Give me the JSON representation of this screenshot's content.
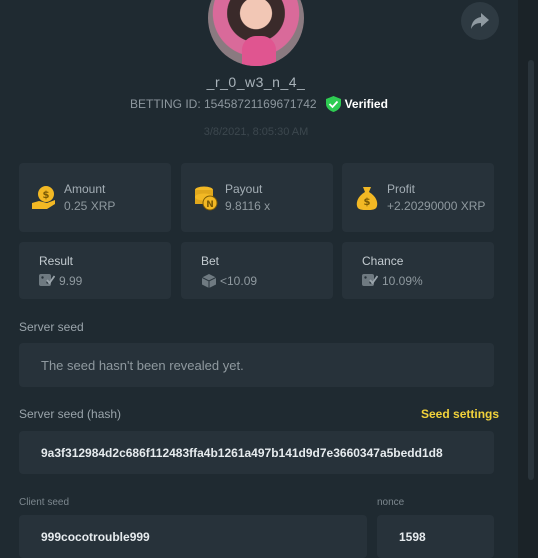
{
  "profile": {
    "username": "_r_0_w3_n_4_",
    "betting_id_label": "BETTING ID: 15458721169671742",
    "verified_label": "Verified",
    "datetime": "3/8/2021, 8:05:30 AM"
  },
  "stats": {
    "amount": {
      "label": "Amount",
      "value": "0.25 XRP"
    },
    "payout": {
      "label": "Payout",
      "value": "9.8116 x"
    },
    "profit": {
      "label": "Profit",
      "value": "+2.20290000 XRP"
    },
    "result": {
      "label": "Result",
      "value": "9.99"
    },
    "bet": {
      "label": "Bet",
      "value": "<10.09"
    },
    "chance": {
      "label": "Chance",
      "value": "10.09%"
    }
  },
  "server_seed": {
    "label": "Server seed",
    "value": "The seed hasn't been revealed yet."
  },
  "server_seed_hash": {
    "label": "Server seed (hash)",
    "value": "9a3f312984d2c686f112483ffa4b1261a497b141d9d7e3660347a5bedd1d8",
    "settings_link": "Seed settings"
  },
  "client_seed": {
    "label": "Client seed",
    "value": "999cocotrouble999"
  },
  "nonce": {
    "label": "nonce",
    "value": "1598"
  },
  "colors": {
    "background": "#1f2a31",
    "card": "#27323a",
    "accent_gold": "#f2b824",
    "verified_green": "#2ecc52",
    "link_yellow": "#f2d23b"
  },
  "icons": [
    "share-icon",
    "verified-check-icon",
    "coin-hand-icon",
    "coin-stack-icon",
    "money-bag-icon",
    "dice-check-icon",
    "dice-icon"
  ]
}
